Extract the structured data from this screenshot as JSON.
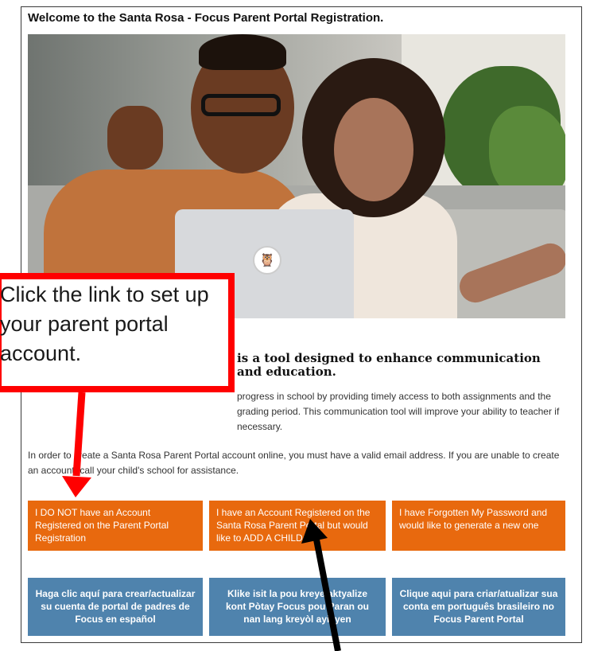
{
  "header": {
    "welcome": "Welcome to the Santa Rosa - Focus Parent Portal Registration."
  },
  "hero": {
    "image_label": "Parent and child celebrating at a laptop",
    "logo_icon": "owl-icon"
  },
  "intro": {
    "title": "is a tool designed to enhance communication and education.",
    "body": "progress in school by providing timely access to both assignments and the grading period. This communication tool will improve your ability to teacher if necessary."
  },
  "required_text": "In order to create a Santa Rosa Parent Portal account online, you must have a valid email address. If you are unable to create an account, call your child's school for assistance.",
  "buttons": {
    "no_account": "I DO NOT have an Account Registered on the Parent Portal Registration",
    "add_child": "I have an Account Registered on the Santa Rosa Parent Portal but would like to ADD A CHILD",
    "forgot_password": "I have Forgotten My Password and would like to generate a new one",
    "spanish": "Haga clic aquí para crear/actualizar su cuenta de portal de padres de Focus en español",
    "creole": "Klike isit la pou kreye/aktyalize kont Pòtay Focus pou Paran ou nan lang kreyòl ayisyen",
    "portuguese": "Clique aqui para criar/atualizar sua conta em português brasileiro no Focus Parent Portal"
  },
  "callout": {
    "text": "Click the link to set up your parent portal account."
  },
  "colors": {
    "orange": "#e8690e",
    "blue": "#4f83ad",
    "callout_border": "#ff0000",
    "arrow": "#000000"
  }
}
